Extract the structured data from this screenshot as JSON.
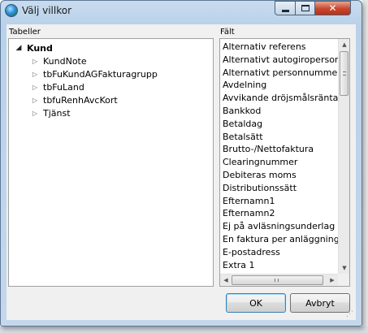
{
  "window": {
    "title": "Välj villkor",
    "icon": "app-globe-icon",
    "controls": {
      "minimize": "minimize-icon",
      "maximize": "maximize-icon",
      "close": "✕"
    }
  },
  "tables_panel": {
    "label": "Tabeller",
    "root": {
      "label": "Kund",
      "expanded": true
    },
    "children": [
      {
        "label": "KundNote"
      },
      {
        "label": "tbFuKundAGFakturagrupp"
      },
      {
        "label": "tbFuLand"
      },
      {
        "label": "tbfuRenhAvcKort"
      },
      {
        "label": "Tjänst"
      }
    ]
  },
  "fields_panel": {
    "label": "Fält",
    "items": [
      "Alternativ referens",
      "Alternativt autogiropersonn",
      "Alternativt personnummer a",
      "Avdelning",
      "Avvikande dröjsmålsränta",
      "Bankkod",
      "Betaldag",
      "Betalsätt",
      "Brutto-/Nettofaktura",
      "Clearingnummer",
      "Debiteras moms",
      "Distributionssätt",
      "Efternamn1",
      "Efternamn2",
      "Ej på avläsningsunderlag",
      "En faktura per anläggning",
      "E-postadress",
      "Extra 1"
    ]
  },
  "buttons": {
    "ok": "OK",
    "cancel": "Avbryt"
  }
}
